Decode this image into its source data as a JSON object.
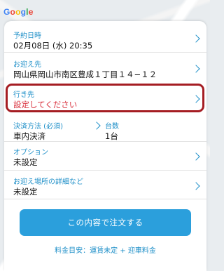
{
  "map": {
    "logo_letters": [
      "G",
      "o",
      "o",
      "g",
      "l",
      "e"
    ]
  },
  "booking": {
    "datetime": {
      "label": "予約日時",
      "value": "02月08日 (水) 20:35"
    },
    "pickup": {
      "label": "お迎え先",
      "value": "岡山県岡山市南区豊成１丁目１４−１２"
    },
    "destination": {
      "label": "行き先",
      "value": "設定してください"
    },
    "payment": {
      "label": "決済方法 (必須)",
      "value": "車内決済"
    },
    "cars": {
      "label": "台数",
      "value": "1台"
    },
    "options": {
      "label": "オプション",
      "value": "未設定"
    },
    "pickup_details": {
      "label": "お迎え場所の詳細など",
      "value": "未設定"
    },
    "order_button": "この内容で注文する",
    "fare_note": "料金目安：運賃未定 + 迎車料金"
  },
  "colors": {
    "accent": "#1e8fc8",
    "button": "#2b9fdc",
    "alert": "#d9333f",
    "highlight_border": "#a51d23"
  }
}
